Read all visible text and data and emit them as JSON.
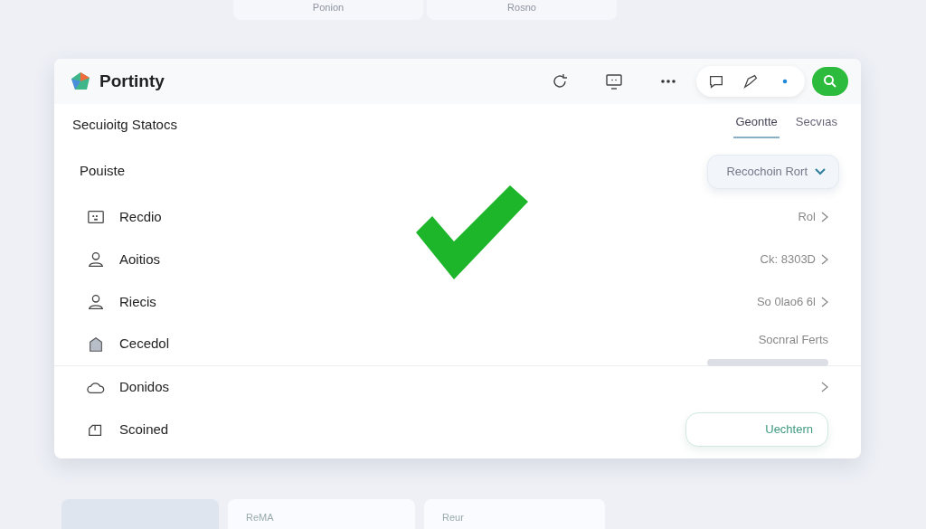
{
  "background_top_cards": [
    "Ponion",
    "Rosno"
  ],
  "app": {
    "title": "Portinty"
  },
  "section_title": "Secuioitg Statocs",
  "tabs": [
    {
      "label": "Geontte",
      "selected": true
    },
    {
      "label": "Secvıas",
      "selected": false
    }
  ],
  "list_heading": "Pouiste",
  "dropdown": {
    "label": "Recochoin Rort"
  },
  "rows": [
    {
      "label": "Recdio",
      "kind": "link",
      "value": "Rol"
    },
    {
      "label": "Aoitios",
      "kind": "link",
      "value": "Ck: 8303D"
    },
    {
      "label": "Riecis",
      "kind": "link",
      "value": "So 0lao6 6l"
    },
    {
      "label": "Cecedol",
      "kind": "bar",
      "value": "Socnral Ferts"
    },
    {
      "label": "Donidos",
      "kind": "chevron"
    },
    {
      "label": "Scoined",
      "kind": "button",
      "value": "Uechtern"
    }
  ],
  "background_bottom_cards": [
    "ReMA",
    "Reur"
  ]
}
